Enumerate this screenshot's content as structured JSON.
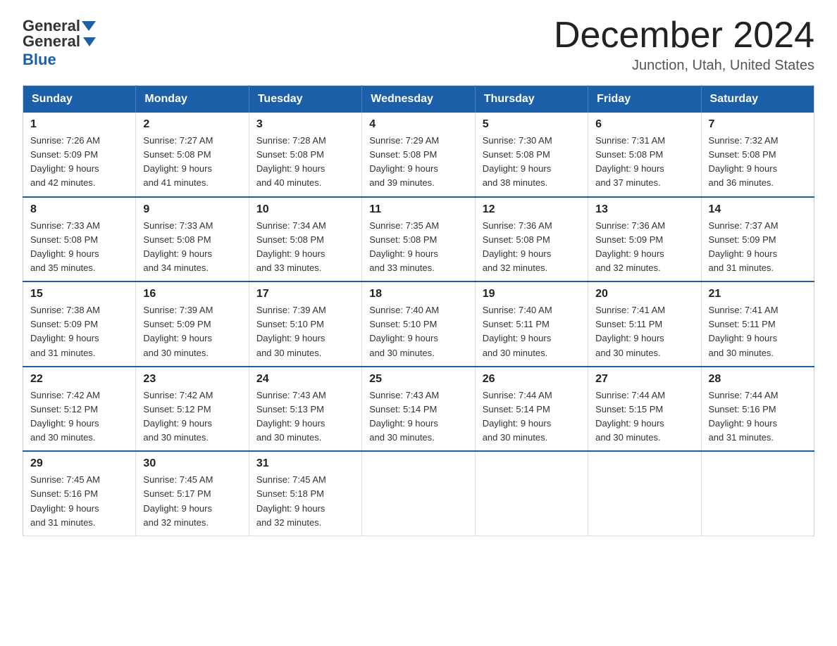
{
  "logo": {
    "general": "General",
    "blue": "Blue"
  },
  "title": "December 2024",
  "location": "Junction, Utah, United States",
  "days_of_week": [
    "Sunday",
    "Monday",
    "Tuesday",
    "Wednesday",
    "Thursday",
    "Friday",
    "Saturday"
  ],
  "weeks": [
    [
      {
        "day": "1",
        "sunrise": "7:26 AM",
        "sunset": "5:09 PM",
        "daylight": "9 hours and 42 minutes."
      },
      {
        "day": "2",
        "sunrise": "7:27 AM",
        "sunset": "5:08 PM",
        "daylight": "9 hours and 41 minutes."
      },
      {
        "day": "3",
        "sunrise": "7:28 AM",
        "sunset": "5:08 PM",
        "daylight": "9 hours and 40 minutes."
      },
      {
        "day": "4",
        "sunrise": "7:29 AM",
        "sunset": "5:08 PM",
        "daylight": "9 hours and 39 minutes."
      },
      {
        "day": "5",
        "sunrise": "7:30 AM",
        "sunset": "5:08 PM",
        "daylight": "9 hours and 38 minutes."
      },
      {
        "day": "6",
        "sunrise": "7:31 AM",
        "sunset": "5:08 PM",
        "daylight": "9 hours and 37 minutes."
      },
      {
        "day": "7",
        "sunrise": "7:32 AM",
        "sunset": "5:08 PM",
        "daylight": "9 hours and 36 minutes."
      }
    ],
    [
      {
        "day": "8",
        "sunrise": "7:33 AM",
        "sunset": "5:08 PM",
        "daylight": "9 hours and 35 minutes."
      },
      {
        "day": "9",
        "sunrise": "7:33 AM",
        "sunset": "5:08 PM",
        "daylight": "9 hours and 34 minutes."
      },
      {
        "day": "10",
        "sunrise": "7:34 AM",
        "sunset": "5:08 PM",
        "daylight": "9 hours and 33 minutes."
      },
      {
        "day": "11",
        "sunrise": "7:35 AM",
        "sunset": "5:08 PM",
        "daylight": "9 hours and 33 minutes."
      },
      {
        "day": "12",
        "sunrise": "7:36 AM",
        "sunset": "5:08 PM",
        "daylight": "9 hours and 32 minutes."
      },
      {
        "day": "13",
        "sunrise": "7:36 AM",
        "sunset": "5:09 PM",
        "daylight": "9 hours and 32 minutes."
      },
      {
        "day": "14",
        "sunrise": "7:37 AM",
        "sunset": "5:09 PM",
        "daylight": "9 hours and 31 minutes."
      }
    ],
    [
      {
        "day": "15",
        "sunrise": "7:38 AM",
        "sunset": "5:09 PM",
        "daylight": "9 hours and 31 minutes."
      },
      {
        "day": "16",
        "sunrise": "7:39 AM",
        "sunset": "5:09 PM",
        "daylight": "9 hours and 30 minutes."
      },
      {
        "day": "17",
        "sunrise": "7:39 AM",
        "sunset": "5:10 PM",
        "daylight": "9 hours and 30 minutes."
      },
      {
        "day": "18",
        "sunrise": "7:40 AM",
        "sunset": "5:10 PM",
        "daylight": "9 hours and 30 minutes."
      },
      {
        "day": "19",
        "sunrise": "7:40 AM",
        "sunset": "5:11 PM",
        "daylight": "9 hours and 30 minutes."
      },
      {
        "day": "20",
        "sunrise": "7:41 AM",
        "sunset": "5:11 PM",
        "daylight": "9 hours and 30 minutes."
      },
      {
        "day": "21",
        "sunrise": "7:41 AM",
        "sunset": "5:11 PM",
        "daylight": "9 hours and 30 minutes."
      }
    ],
    [
      {
        "day": "22",
        "sunrise": "7:42 AM",
        "sunset": "5:12 PM",
        "daylight": "9 hours and 30 minutes."
      },
      {
        "day": "23",
        "sunrise": "7:42 AM",
        "sunset": "5:12 PM",
        "daylight": "9 hours and 30 minutes."
      },
      {
        "day": "24",
        "sunrise": "7:43 AM",
        "sunset": "5:13 PM",
        "daylight": "9 hours and 30 minutes."
      },
      {
        "day": "25",
        "sunrise": "7:43 AM",
        "sunset": "5:14 PM",
        "daylight": "9 hours and 30 minutes."
      },
      {
        "day": "26",
        "sunrise": "7:44 AM",
        "sunset": "5:14 PM",
        "daylight": "9 hours and 30 minutes."
      },
      {
        "day": "27",
        "sunrise": "7:44 AM",
        "sunset": "5:15 PM",
        "daylight": "9 hours and 30 minutes."
      },
      {
        "day": "28",
        "sunrise": "7:44 AM",
        "sunset": "5:16 PM",
        "daylight": "9 hours and 31 minutes."
      }
    ],
    [
      {
        "day": "29",
        "sunrise": "7:45 AM",
        "sunset": "5:16 PM",
        "daylight": "9 hours and 31 minutes."
      },
      {
        "day": "30",
        "sunrise": "7:45 AM",
        "sunset": "5:17 PM",
        "daylight": "9 hours and 32 minutes."
      },
      {
        "day": "31",
        "sunrise": "7:45 AM",
        "sunset": "5:18 PM",
        "daylight": "9 hours and 32 minutes."
      },
      null,
      null,
      null,
      null
    ]
  ],
  "sunrise_label": "Sunrise:",
  "sunset_label": "Sunset:",
  "daylight_label": "Daylight:"
}
